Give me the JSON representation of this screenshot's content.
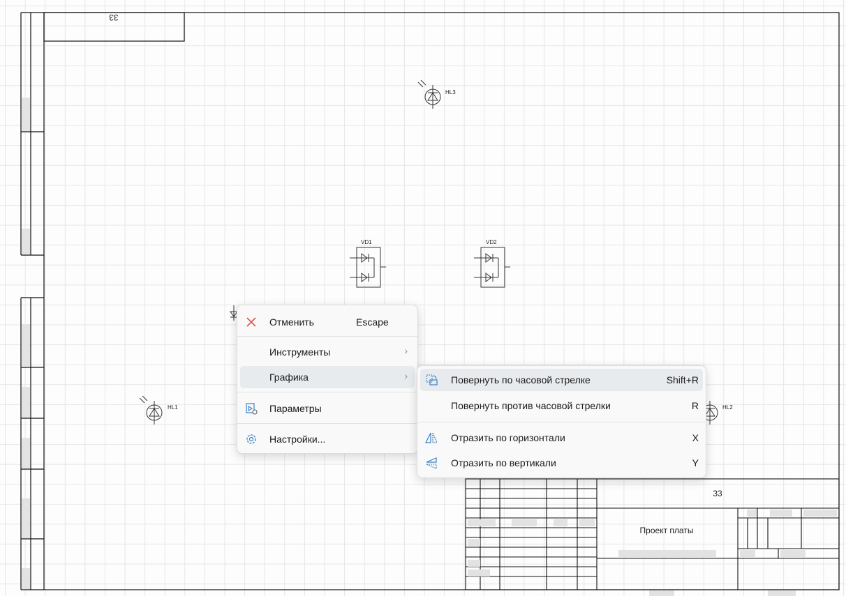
{
  "sheet": {
    "rotated_label": "33",
    "symbols": [
      {
        "ref": "HL3"
      },
      {
        "ref": "VD1"
      },
      {
        "ref": "VD2"
      },
      {
        "ref": "HL1"
      },
      {
        "ref": "HL2"
      }
    ],
    "title_block": {
      "code": "33",
      "name": "Проект платы"
    }
  },
  "context_menu": {
    "items": [
      {
        "label": "Отменить",
        "shortcut": "Escape",
        "icon": "close-icon"
      },
      {
        "label": "Инструменты",
        "submenu": true
      },
      {
        "label": "Графика",
        "submenu": true,
        "highlighted": true
      },
      {
        "label": "Параметры",
        "icon": "parameters-icon"
      },
      {
        "label": "Настройки...",
        "icon": "gear-icon"
      }
    ]
  },
  "submenu": {
    "items": [
      {
        "label": "Повернуть по часовой стрелке",
        "shortcut": "Shift+R",
        "icon": "rotate-clockwise-icon",
        "highlighted": true
      },
      {
        "label": "Повернуть против часовой стрелки",
        "shortcut": "R"
      },
      {
        "label": "Отразить по горизонтали",
        "shortcut": "X",
        "icon": "flip-horizontal-icon"
      },
      {
        "label": "Отразить по вертикали",
        "shortcut": "Y",
        "icon": "flip-vertical-icon"
      }
    ]
  },
  "colors": {
    "accent": "#3b7fc4",
    "danger": "#d9534f",
    "highlight": "#e8ebee"
  }
}
